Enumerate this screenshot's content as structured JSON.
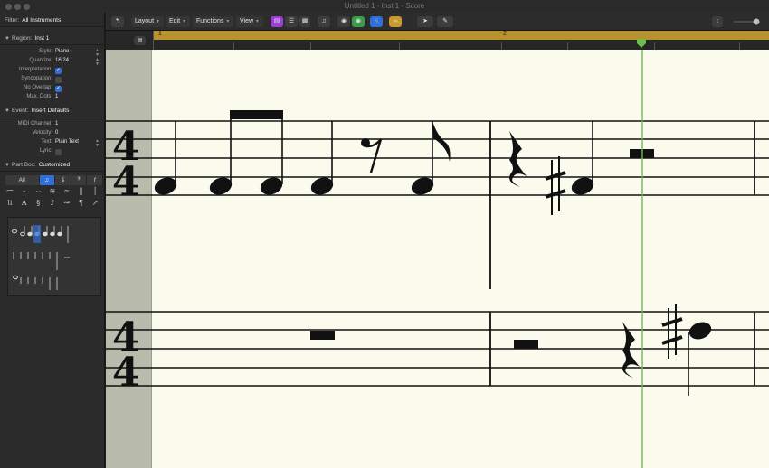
{
  "window": {
    "title": "Untitled 1 - Inst 1 - Score"
  },
  "inspector": {
    "filter": {
      "label": "Filter:",
      "value": "All Instruments"
    },
    "region": {
      "label": "Region:",
      "value": "Inst 1",
      "params": {
        "style": {
          "label": "Style:",
          "value": "Piano"
        },
        "quantize": {
          "label": "Quantize:",
          "value": "16,24"
        },
        "interpretation": {
          "label": "Interpretation:",
          "checked": true
        },
        "syncopation": {
          "label": "Syncopation:",
          "checked": false
        },
        "no_overlap": {
          "label": "No Overlap:",
          "checked": true
        },
        "max_dots": {
          "label": "Max. Dots:",
          "value": "1"
        }
      }
    },
    "event": {
      "label": "Event:",
      "value": "Insert Defaults",
      "params": {
        "midi_channel": {
          "label": "MIDI Channel:",
          "value": "1"
        },
        "velocity": {
          "label": "Velocity:",
          "value": "0"
        },
        "text": {
          "label": "Text:",
          "value": "Plain Text"
        },
        "lyric": {
          "label": "Lyric:",
          "checked": false
        }
      }
    },
    "part_box": {
      "label": "Part Box:",
      "value": "Customized",
      "filter_all": "All"
    }
  },
  "toolbar": {
    "layout": "Layout",
    "edit": "Edit",
    "functions": "Functions",
    "view": "View"
  },
  "ruler": {
    "bar1": "1",
    "bar2": "2"
  },
  "score": {
    "time_signature": {
      "top": "4",
      "bottom": "4"
    },
    "playhead_color": "#6bbd4f",
    "accent_purple": "#9b3fd4",
    "accent_green": "#3c9a4b",
    "accent_blue": "#2f6fd6",
    "accent_yellow": "#c89a2a"
  }
}
